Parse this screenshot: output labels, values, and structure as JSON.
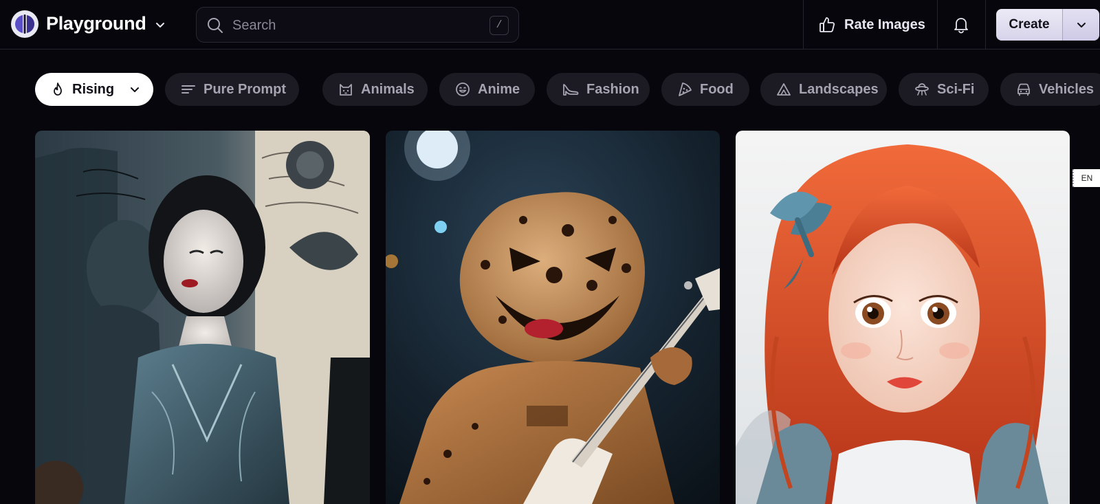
{
  "header": {
    "brand": "Playground",
    "search": {
      "placeholder": "Search",
      "shortcut": "/"
    },
    "rate_label": "Rate Images",
    "create_label": "Create"
  },
  "categories": [
    {
      "label": "Rising",
      "icon": "flame-icon",
      "active": true
    },
    {
      "label": "Pure Prompt",
      "icon": "lines-icon"
    },
    {
      "label": "Animals",
      "icon": "cat-icon"
    },
    {
      "label": "Anime",
      "icon": "smile-icon"
    },
    {
      "label": "Fashion",
      "icon": "heel-icon"
    },
    {
      "label": "Food",
      "icon": "pizza-icon"
    },
    {
      "label": "Landscapes",
      "icon": "mountain-icon"
    },
    {
      "label": "Sci-Fi",
      "icon": "ufo-icon"
    },
    {
      "label": "Vehicles",
      "icon": "car-icon"
    }
  ],
  "gallery": [
    {
      "subject": "vintage-woman"
    },
    {
      "subject": "cookie-guitarist"
    },
    {
      "subject": "redhead-girl"
    }
  ],
  "language_tag": "EN",
  "colors": {
    "background": "#07060d",
    "chip": "#1c1a23",
    "chip_active": "#ffffff",
    "create_button": "#e3e0f2"
  }
}
